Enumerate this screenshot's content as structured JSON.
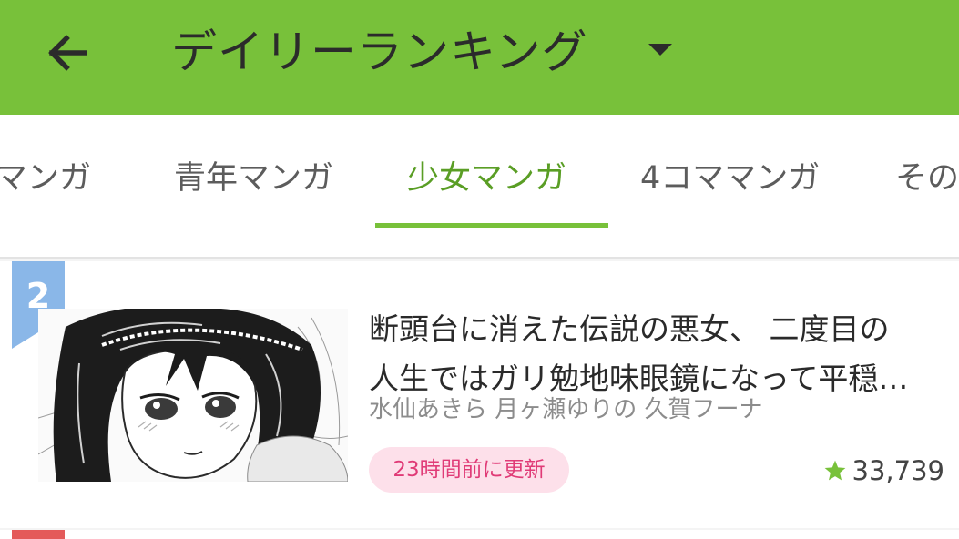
{
  "appbar": {
    "title": "デイリーランキング",
    "back_icon": "arrow-left-icon",
    "dropdown_icon": "caret-down-icon",
    "color": "#78c13a"
  },
  "tabs": [
    {
      "label": "年マンガ"
    },
    {
      "label": "青年マンガ"
    },
    {
      "label": "少女マンガ",
      "active": true
    },
    {
      "label": "4コママンガ"
    },
    {
      "label": "その"
    }
  ],
  "ranking": {
    "rank": "2",
    "title_line1": "断頭台に消えた伝説の悪女、 二度目の",
    "title_line2": "人生ではガリ勉地味眼鏡になって平穏…",
    "authors": "水仙あきら 月ヶ瀬ゆりの 久賀フーナ",
    "update": "23時間前に更新",
    "rating_icon": "star-icon",
    "rating": "33,739",
    "colors": {
      "ribbon": "#8ab7e8",
      "badge_bg": "#fde0ea",
      "badge_text": "#e03b77",
      "star": "#78c13a"
    }
  }
}
